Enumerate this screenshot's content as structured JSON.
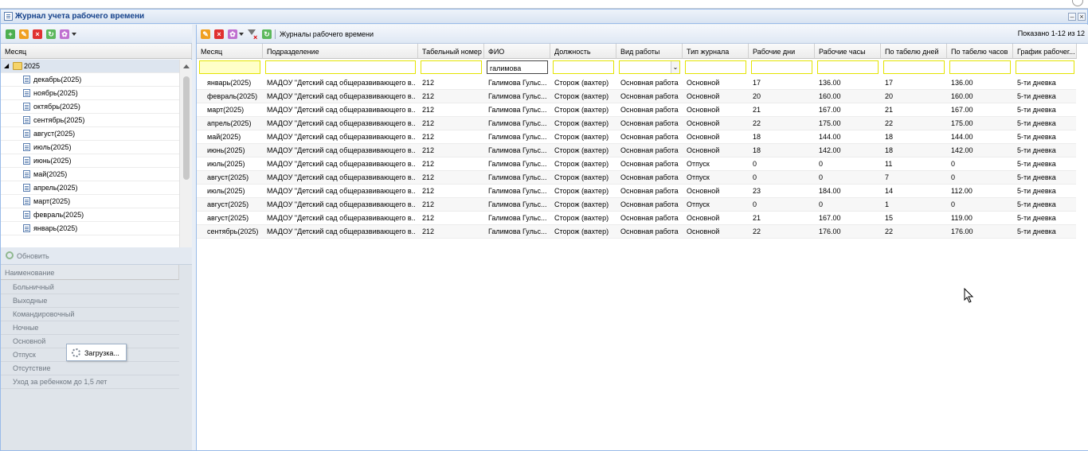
{
  "window": {
    "title": "Журнал учета рабочего времени"
  },
  "left_panel": {
    "column_header": "Месяц",
    "tree_root": "2025",
    "months": [
      "декабрь(2025)",
      "ноябрь(2025)",
      "октябрь(2025)",
      "сентябрь(2025)",
      "август(2025)",
      "июль(2025)",
      "июнь(2025)",
      "май(2025)",
      "апрель(2025)",
      "март(2025)",
      "февраль(2025)",
      "январь(2025)"
    ],
    "refresh_label": "Обновить",
    "names_header": "Наименование",
    "names": [
      "Больничный",
      "Выходные",
      "Командировочный",
      "Ночные",
      "Основной",
      "Отпуск",
      "Отсутствие",
      "Уход за ребенком до 1,5 лет"
    ],
    "loading_text": "Загрузка..."
  },
  "right_panel": {
    "toolbar_title": "Журналы рабочего времени",
    "paging": "Показано 1-12 из 12",
    "columns": [
      "Месяц",
      "Подразделение",
      "Табельный номер",
      "ФИО",
      "Должность",
      "Вид работы",
      "Тип журнала",
      "Рабочие дни",
      "Рабочие часы",
      "По табелю дней",
      "По табелю часов",
      "График рабочег..."
    ],
    "filter_fio": "галимова",
    "rows": [
      [
        "январь(2025)",
        "МАДОУ \"Детский сад общеразвивающего в...",
        "212",
        "Галимова Гульс...",
        "Сторож (вахтер)",
        "Основная работа",
        "Основной",
        "17",
        "136.00",
        "17",
        "136.00",
        "5-ти дневка"
      ],
      [
        "февраль(2025)",
        "МАДОУ \"Детский сад общеразвивающего в...",
        "212",
        "Галимова Гульс...",
        "Сторож (вахтер)",
        "Основная работа",
        "Основной",
        "20",
        "160.00",
        "20",
        "160.00",
        "5-ти дневка"
      ],
      [
        "март(2025)",
        "МАДОУ \"Детский сад общеразвивающего в...",
        "212",
        "Галимова Гульс...",
        "Сторож (вахтер)",
        "Основная работа",
        "Основной",
        "21",
        "167.00",
        "21",
        "167.00",
        "5-ти дневка"
      ],
      [
        "апрель(2025)",
        "МАДОУ \"Детский сад общеразвивающего в...",
        "212",
        "Галимова Гульс...",
        "Сторож (вахтер)",
        "Основная работа",
        "Основной",
        "22",
        "175.00",
        "22",
        "175.00",
        "5-ти дневка"
      ],
      [
        "май(2025)",
        "МАДОУ \"Детский сад общеразвивающего в...",
        "212",
        "Галимова Гульс...",
        "Сторож (вахтер)",
        "Основная работа",
        "Основной",
        "18",
        "144.00",
        "18",
        "144.00",
        "5-ти дневка"
      ],
      [
        "июнь(2025)",
        "МАДОУ \"Детский сад общеразвивающего в...",
        "212",
        "Галимова Гульс...",
        "Сторож (вахтер)",
        "Основная работа",
        "Основной",
        "18",
        "142.00",
        "18",
        "142.00",
        "5-ти дневка"
      ],
      [
        "июль(2025)",
        "МАДОУ \"Детский сад общеразвивающего в...",
        "212",
        "Галимова Гульс...",
        "Сторож (вахтер)",
        "Основная работа",
        "Отпуск",
        "0",
        "0",
        "11",
        "0",
        "5-ти дневка"
      ],
      [
        "август(2025)",
        "МАДОУ \"Детский сад общеразвивающего в...",
        "212",
        "Галимова Гульс...",
        "Сторож (вахтер)",
        "Основная работа",
        "Отпуск",
        "0",
        "0",
        "7",
        "0",
        "5-ти дневка"
      ],
      [
        "июль(2025)",
        "МАДОУ \"Детский сад общеразвивающего в...",
        "212",
        "Галимова Гульс...",
        "Сторож (вахтер)",
        "Основная работа",
        "Основной",
        "23",
        "184.00",
        "14",
        "112.00",
        "5-ти дневка"
      ],
      [
        "август(2025)",
        "МАДОУ \"Детский сад общеразвивающего в...",
        "212",
        "Галимова Гульс...",
        "Сторож (вахтер)",
        "Основная работа",
        "Отпуск",
        "0",
        "0",
        "1",
        "0",
        "5-ти дневка"
      ],
      [
        "август(2025)",
        "МАДОУ \"Детский сад общеразвивающего в...",
        "212",
        "Галимова Гульс...",
        "Сторож (вахтер)",
        "Основная работа",
        "Основной",
        "21",
        "167.00",
        "15",
        "119.00",
        "5-ти дневка"
      ],
      [
        "сентябрь(2025)",
        "МАДОУ \"Детский сад общеразвивающего в...",
        "212",
        "Галимова Гульс...",
        "Сторож (вахтер)",
        "Основная работа",
        "Основной",
        "22",
        "176.00",
        "22",
        "176.00",
        "5-ти дневка"
      ]
    ]
  },
  "colors": {
    "accent": "#15428b",
    "filter_border": "#e4e400",
    "add": "#4caf50",
    "edit": "#f0a020",
    "delete": "#e03030",
    "refresh": "#5cb85c",
    "settings": "#c070d0"
  }
}
